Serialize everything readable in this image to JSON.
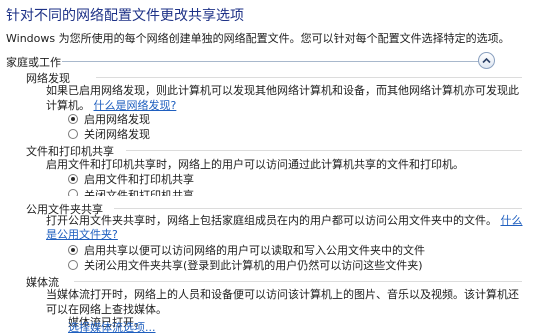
{
  "header": {
    "title": "针对不同的网络配置文件更改共享选项",
    "subtitle": "Windows 为您所使用的每个网络创建单独的网络配置文件。您可以针对每个配置文件选择特定的选项。"
  },
  "group": {
    "label": "家庭或工作"
  },
  "sections": [
    {
      "title": "网络发现",
      "desc_line1": "如果已启用网络发现，则此计算机可以发现其他网络计算机和设备，而其他网络计算机亦可发现此",
      "desc_line2": "计算机。",
      "link": "什么是网络发现?",
      "options": [
        "启用网络发现",
        "关闭网络发现"
      ]
    },
    {
      "title": "文件和打印机共享",
      "desc_line1": "启用文件和打印机共享时，网络上的用户可以访问通过此计算机共享的文件和打印机。",
      "options": [
        "启用文件和打印机共享",
        "关闭文件和打印机共享"
      ]
    },
    {
      "title": "公用文件夹共享",
      "desc_line1": "打开公用文件夹共享时，网络上包括家庭组成员在内的用户都可以访问公用文件夹中的文件。",
      "link_a": "什么",
      "link_b": "是公用文件夹?",
      "options": [
        "启用共享以便可以访问网络的用户可以读取和写入公用文件夹中的文件",
        "关闭公用文件夹共享(登录到此计算机的用户仍然可以访问这些文件夹)"
      ]
    },
    {
      "title": "媒体流",
      "desc_line1": "当媒体流打开时，网络上的人员和设备便可以访问该计算机上的图片、音乐以及视频。该计算机还",
      "desc_line2": "可以在网络上查找媒体。",
      "status": "媒体流已打开。",
      "link": "选择媒体流选项..."
    }
  ]
}
